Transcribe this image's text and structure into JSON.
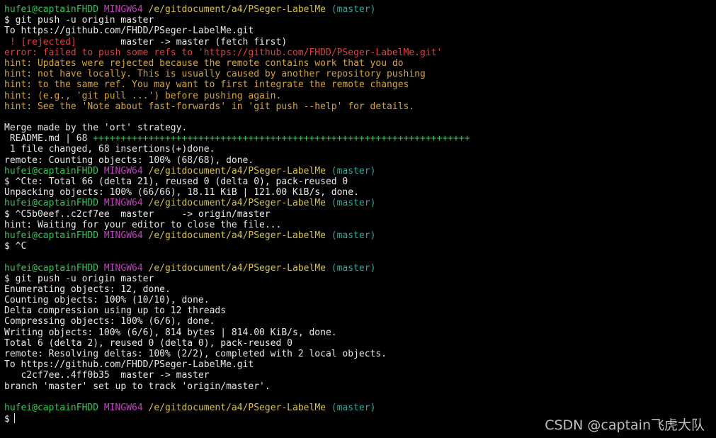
{
  "colors": {
    "default": "#e8e8e8",
    "user": "#34c759",
    "system": "#c63fc1",
    "path": "#d8c24a",
    "branch": "#2ba9a2",
    "error": "#e04040",
    "hint": "#d6a53a",
    "plus": "#34c759"
  },
  "terminal": {
    "lines": [
      [
        {
          "t": "hufei@captainFHDD ",
          "c": "user"
        },
        {
          "t": "MINGW64 ",
          "c": "system"
        },
        {
          "t": "/e/gitdocument/a4/PSeger-LabelMe ",
          "c": "path"
        },
        {
          "t": "(master)",
          "c": "branch"
        }
      ],
      [
        {
          "t": "$ git push -u origin master"
        }
      ],
      [
        {
          "t": "To https://github.com/FHDD/PSeger-LabelMe.git"
        }
      ],
      [
        {
          "t": " ! [rejected]",
          "c": "error"
        },
        {
          "t": "        master -> master (fetch first)"
        }
      ],
      [
        {
          "t": "error: failed to push some refs to 'https://github.com/FHDD/PSeger-LabelMe.git'",
          "c": "error"
        }
      ],
      [
        {
          "t": "hint: Updates were rejected because the remote contains work that you do",
          "c": "hint"
        }
      ],
      [
        {
          "t": "hint: not have locally. This is usually caused by another repository pushing",
          "c": "hint"
        }
      ],
      [
        {
          "t": "hint: to the same ref. You may want to first integrate the remote changes",
          "c": "hint"
        }
      ],
      [
        {
          "t": "hint: (e.g., 'git pull ...') before pushing again.",
          "c": "hint"
        }
      ],
      [
        {
          "t": "hint: See the 'Note about fast-forwards' in 'git push --help' for details.",
          "c": "hint"
        }
      ],
      [],
      [
        {
          "t": "Merge made by the 'ort' strategy."
        }
      ],
      [
        {
          "t": " README.md | 68 "
        },
        {
          "t": "++++++++++++++++++++++++++++++++++++++++++++++++++++++++++++++++++++",
          "c": "plus"
        }
      ],
      [
        {
          "t": " 1 file changed, 68 insertions(+)done."
        }
      ],
      [
        {
          "t": "remote: Counting objects: 100% (68/68), done."
        }
      ],
      [
        {
          "t": "hufei@captainFHDD ",
          "c": "user"
        },
        {
          "t": "MINGW64 ",
          "c": "system"
        },
        {
          "t": "/e/gitdocument/a4/PSeger-LabelMe ",
          "c": "path"
        },
        {
          "t": "(master)",
          "c": "branch"
        }
      ],
      [
        {
          "t": "$ ^Cte: Total 66 (delta 21), reused 0 (delta 0), pack-reused 0"
        }
      ],
      [
        {
          "t": "Unpacking objects: 100% (66/66), 18.11 KiB | 121.00 KiB/s, done."
        }
      ],
      [
        {
          "t": "hufei@captainFHDD ",
          "c": "user"
        },
        {
          "t": "MINGW64 ",
          "c": "system"
        },
        {
          "t": "/e/gitdocument/a4/PSeger-LabelMe ",
          "c": "path"
        },
        {
          "t": "(master)",
          "c": "branch"
        }
      ],
      [
        {
          "t": "$ ^C5b0eef..c2cf7ee  master     -> origin/master"
        }
      ],
      [
        {
          "t": "hint: Waiting for your editor to close the file..."
        }
      ],
      [
        {
          "t": "hufei@captainFHDD ",
          "c": "user"
        },
        {
          "t": "MINGW64 ",
          "c": "system"
        },
        {
          "t": "/e/gitdocument/a4/PSeger-LabelMe ",
          "c": "path"
        },
        {
          "t": "(master)",
          "c": "branch"
        }
      ],
      [
        {
          "t": "$ ^C"
        }
      ],
      [],
      [
        {
          "t": "hufei@captainFHDD ",
          "c": "user"
        },
        {
          "t": "MINGW64 ",
          "c": "system"
        },
        {
          "t": "/e/gitdocument/a4/PSeger-LabelMe ",
          "c": "path"
        },
        {
          "t": "(master)",
          "c": "branch"
        }
      ],
      [
        {
          "t": "$ git push -u origin master"
        }
      ],
      [
        {
          "t": "Enumerating objects: 12, done."
        }
      ],
      [
        {
          "t": "Counting objects: 100% (10/10), done."
        }
      ],
      [
        {
          "t": "Delta compression using up to 12 threads"
        }
      ],
      [
        {
          "t": "Compressing objects: 100% (6/6), done."
        }
      ],
      [
        {
          "t": "Writing objects: 100% (6/6), 814 bytes | 814.00 KiB/s, done."
        }
      ],
      [
        {
          "t": "Total 6 (delta 2), reused 0 (delta 0), pack-reused 0"
        }
      ],
      [
        {
          "t": "remote: Resolving deltas: 100% (2/2), completed with 2 local objects."
        }
      ],
      [
        {
          "t": "To https://github.com/FHDD/PSeger-LabelMe.git"
        }
      ],
      [
        {
          "t": "   c2cf7ee..4ff0b35  master -> master"
        }
      ],
      [
        {
          "t": "branch 'master' set up to track 'origin/master'."
        }
      ],
      [],
      [
        {
          "t": "hufei@captainFHDD ",
          "c": "user"
        },
        {
          "t": "MINGW64 ",
          "c": "system"
        },
        {
          "t": "/e/gitdocument/a4/PSeger-LabelMe ",
          "c": "path"
        },
        {
          "t": "(master)",
          "c": "branch"
        }
      ]
    ],
    "prompt": "$"
  },
  "watermark": "CSDN @captain飞虎大队"
}
